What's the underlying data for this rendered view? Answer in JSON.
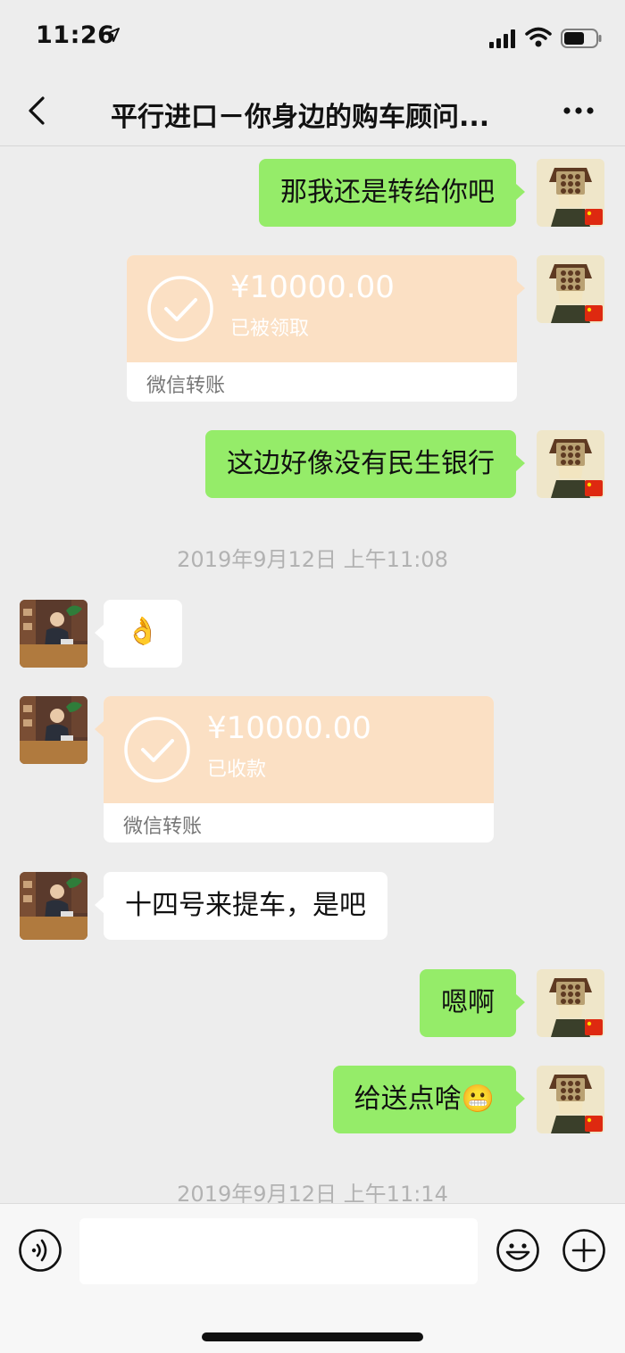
{
  "status_bar": {
    "time": "11:26",
    "location_icon": "location-arrow-icon",
    "signal_icon": "cellular-signal-icon",
    "wifi_icon": "wifi-icon",
    "battery_icon": "battery-icon"
  },
  "nav": {
    "title": "平行进口－你身边的购车顾问...",
    "back_icon": "chevron-left-icon",
    "more_icon": "more-dots-icon"
  },
  "messages": [
    {
      "from": "me",
      "type": "text",
      "text": "那我还是转给你吧"
    },
    {
      "from": "me",
      "type": "transfer",
      "amount": "¥10000.00",
      "status": "已被领取",
      "label": "微信转账"
    },
    {
      "from": "me",
      "type": "text",
      "text": "这边好像没有民生银行"
    },
    {
      "type": "timestamp",
      "text": "2019年9月12日 上午11:08"
    },
    {
      "from": "them",
      "type": "emoji",
      "text": "👌"
    },
    {
      "from": "them",
      "type": "transfer",
      "amount": "¥10000.00",
      "status": "已收款",
      "label": "微信转账"
    },
    {
      "from": "them",
      "type": "text",
      "text": "十四号来提车，是吧"
    },
    {
      "from": "me",
      "type": "text",
      "text": "嗯啊"
    },
    {
      "from": "me",
      "type": "text",
      "text": "给送点啥😬"
    },
    {
      "type": "timestamp",
      "text": "2019年9月12日 上午11:14"
    }
  ],
  "input_bar": {
    "voice_icon": "voice-icon",
    "emoji_icon": "smiley-icon",
    "plus_icon": "plus-icon",
    "input_value": ""
  },
  "colors": {
    "my_bubble": "#95ec69",
    "their_bubble": "#ffffff",
    "transfer_bg": "#fbe0c4",
    "background": "#ededed",
    "timestamp": "#b2b2b2"
  }
}
